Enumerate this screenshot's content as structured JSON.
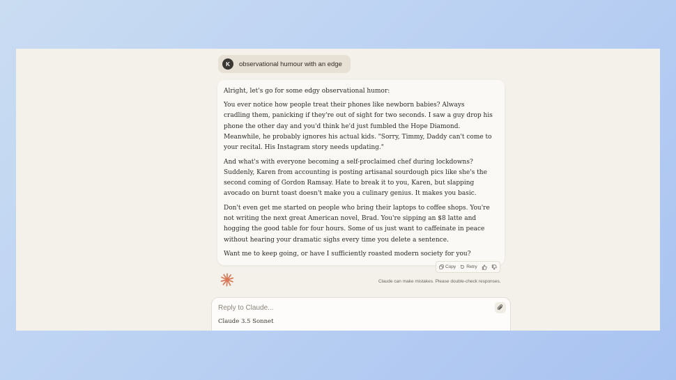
{
  "user_message": {
    "avatar_initial": "K",
    "text": "observational humour with an edge"
  },
  "response": {
    "paragraphs": [
      "Alright, let's go for some edgy observational humor:",
      "You ever notice how people treat their phones like newborn babies? Always cradling them, panicking if they're out of sight for two seconds. I saw a guy drop his phone the other day and you'd think he'd just fumbled the Hope Diamond. Meanwhile, he probably ignores his actual kids. \"Sorry, Timmy, Daddy can't come to your recital. His Instagram story needs updating.\"",
      "And what's with everyone becoming a self-proclaimed chef during lockdowns? Suddenly, Karen from accounting is posting artisanal sourdough pics like she's the second coming of Gordon Ramsay. Hate to break it to you, Karen, but slapping avocado on burnt toast doesn't make you a culinary genius. It makes you basic.",
      "Don't even get me started on people who bring their laptops to coffee shops. You're not writing the next great American novel, Brad. You're sipping an $8 latte and hogging the good table for four hours. Some of us just want to caffeinate in peace without hearing your dramatic sighs every time you delete a sentence.",
      "Want me to keep going, or have I sufficiently roasted modern society for you?"
    ]
  },
  "actions": {
    "copy_label": "Copy",
    "retry_label": "Retry",
    "icons": [
      "copy-icon",
      "retry-icon",
      "thumbs-up-icon",
      "thumbs-down-icon"
    ]
  },
  "disclaimer": "Claude can make mistakes. Please double-check responses.",
  "composer": {
    "placeholder": "Reply to Claude...",
    "model": "Claude 3.5 Sonnet"
  },
  "colors": {
    "brand_orange": "#d97757",
    "background": "#f3f1ea"
  }
}
